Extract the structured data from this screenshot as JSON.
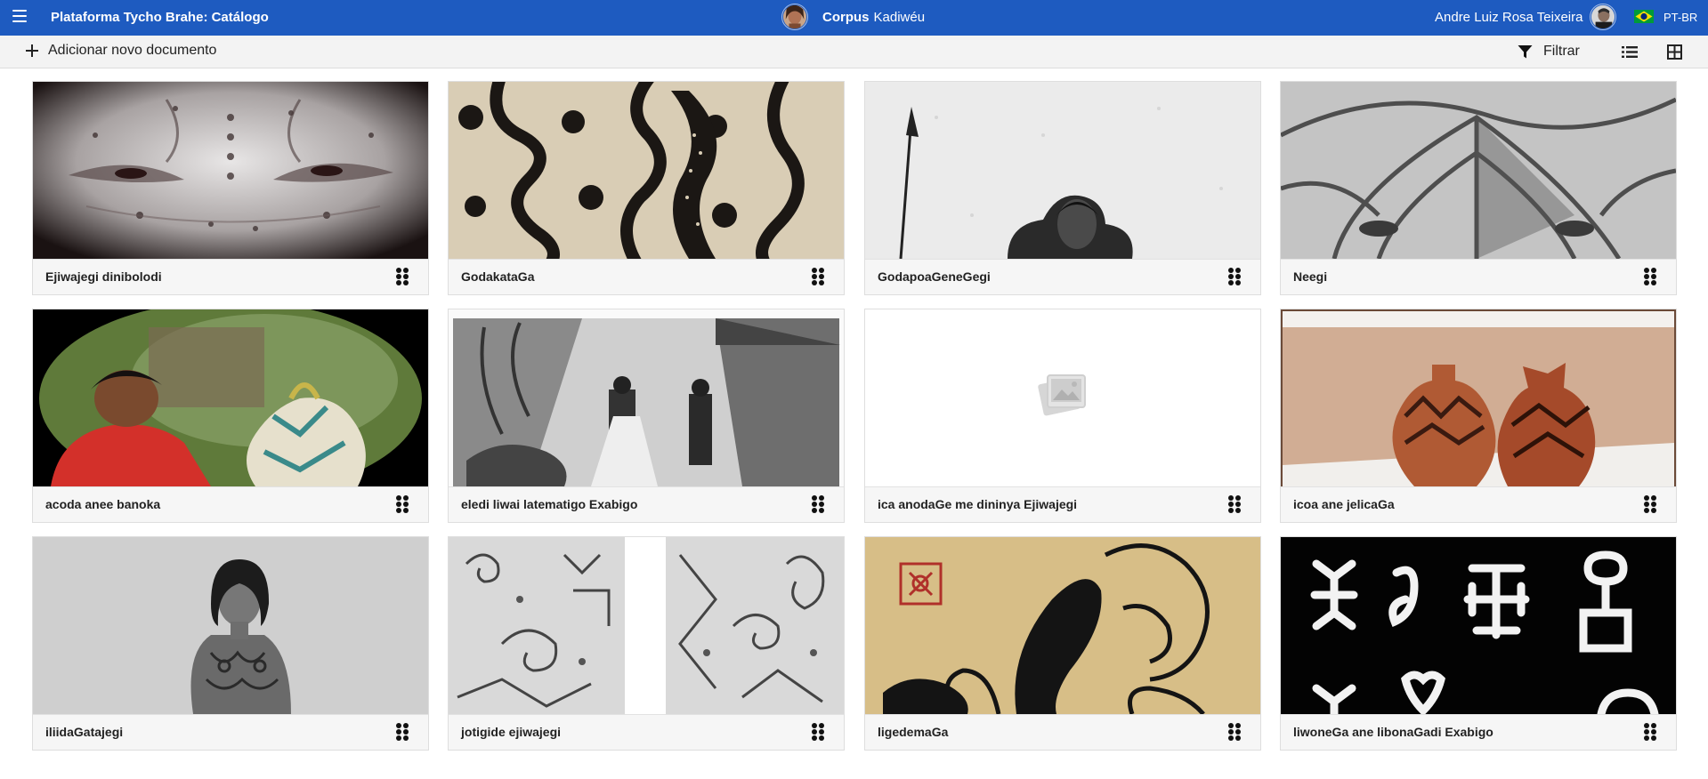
{
  "header": {
    "app_title": "Plataforma Tycho Brahe: Catálogo",
    "corpus_label": "Corpus",
    "corpus_name": "Kadiwéu",
    "user_name": "Andre Luiz Rosa Teixeira",
    "language": "PT-BR",
    "brand_color": "#1e5bc0"
  },
  "toolbar": {
    "add_document_label": "Adicionar novo documento",
    "filter_label": "Filtrar",
    "icons": [
      "plus-icon",
      "filter-icon",
      "list-view-icon",
      "grid-view-icon"
    ]
  },
  "documents": [
    {
      "title": "Ejiwajegi dinibolodi",
      "thumbnail": "tattooed-face-photo"
    },
    {
      "title": "GodakataGa",
      "thumbnail": "black-scroll-pattern"
    },
    {
      "title": "GodapoaGeneGegi",
      "thumbnail": "spear-and-man-drawing"
    },
    {
      "title": "Neegi",
      "thumbnail": "painted-face-sketch"
    },
    {
      "title": "acoda anee banoka",
      "thumbnail": "woman-painting-pottery"
    },
    {
      "title": "eledi liwai latematigo Exabigo",
      "thumbnail": "village-engraving"
    },
    {
      "title": "ica anodaGe me dininya Ejiwajegi",
      "thumbnail": "image-placeholder-icon"
    },
    {
      "title": "icoa ane jelicaGa",
      "thumbnail": "two-ceramic-pots"
    },
    {
      "title": "iliidaGatajegi",
      "thumbnail": "tattooed-woman-photo"
    },
    {
      "title": "jotigide ejiwajegi",
      "thumbnail": "geometric-spiral-drawings"
    },
    {
      "title": "ligedemaGa",
      "thumbnail": "painted-panel-with-seal"
    },
    {
      "title": "liwoneGa ane libonaGadi Exabigo",
      "thumbnail": "white-glyphs-on-black"
    }
  ]
}
